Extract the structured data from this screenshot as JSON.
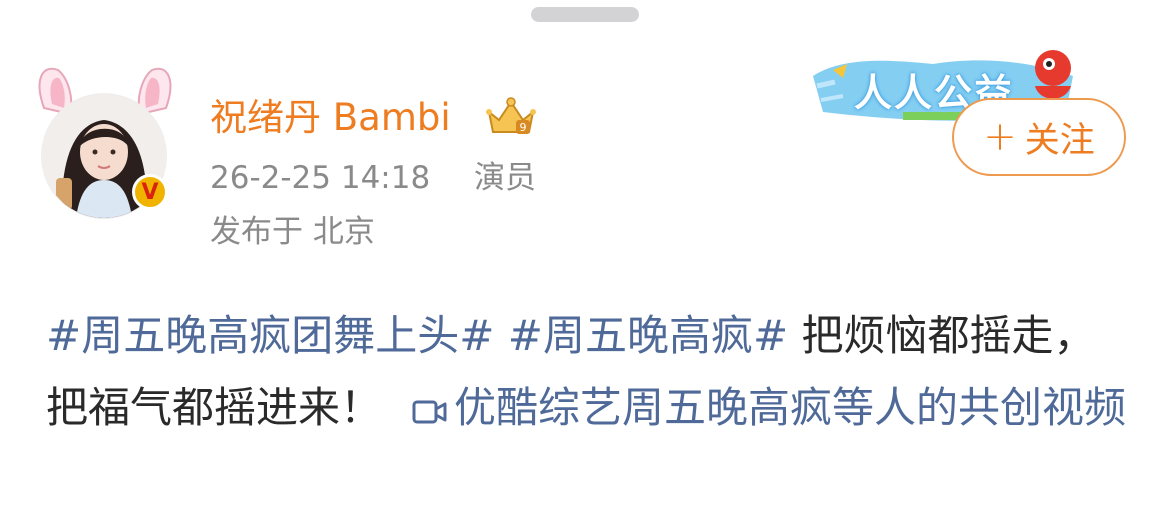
{
  "user": {
    "name": "祝绪丹 Bambi",
    "time": "26-2-25 14:18",
    "role": "演员",
    "location": "发布于 北京",
    "verified_badge": "V"
  },
  "charity": {
    "text": "人人公益"
  },
  "follow_button": {
    "label": "关注",
    "plus": "+"
  },
  "post": {
    "tag1": "#周五晚高疯团舞上头#",
    "tag2": "#周五晚高疯#",
    "text_part1": "把烦恼都摇走，把福气都摇进来！",
    "video_link": "优酷综艺周五晚高疯等人的共创视频"
  },
  "colors": {
    "username": "#ee7d21",
    "link": "#4f6a99",
    "meta": "#8a8a8a"
  }
}
